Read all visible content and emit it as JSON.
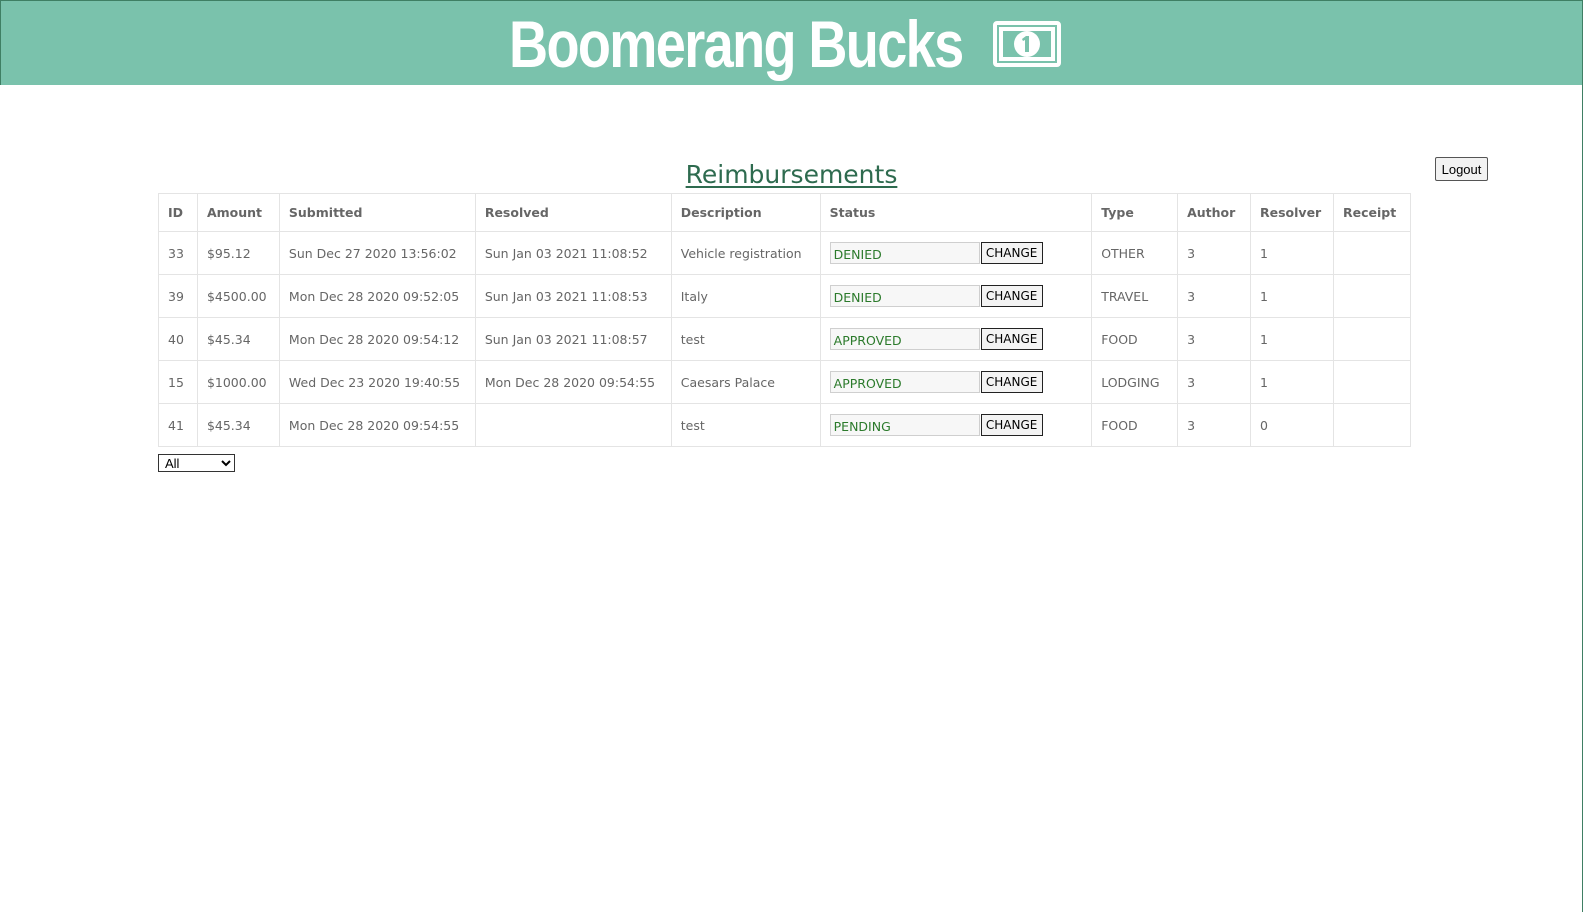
{
  "header": {
    "brand_title": "Boomerang Bucks",
    "icon": "dollar-bill-icon",
    "background_color": "#7ac2ac"
  },
  "page": {
    "title": "Reimbursements",
    "logout_label": "Logout"
  },
  "table": {
    "columns": [
      "ID",
      "Amount",
      "Submitted",
      "Resolved",
      "Description",
      "Status",
      "Type",
      "Author",
      "Resolver",
      "Receipt"
    ],
    "change_label": "CHANGE",
    "rows": [
      {
        "id": "33",
        "amount": "$95.12",
        "submitted": "Sun Dec 27 2020 13:56:02",
        "resolved": "Sun Jan 03 2021 11:08:52",
        "description": "Vehicle registration",
        "status": "DENIED",
        "type": "OTHER",
        "author": "3",
        "resolver": "1",
        "receipt": ""
      },
      {
        "id": "39",
        "amount": "$4500.00",
        "submitted": "Mon Dec 28 2020 09:52:05",
        "resolved": "Sun Jan 03 2021 11:08:53",
        "description": "Italy",
        "status": "DENIED",
        "type": "TRAVEL",
        "author": "3",
        "resolver": "1",
        "receipt": ""
      },
      {
        "id": "40",
        "amount": "$45.34",
        "submitted": "Mon Dec 28 2020 09:54:12",
        "resolved": "Sun Jan 03 2021 11:08:57",
        "description": "test",
        "status": "APPROVED",
        "type": "FOOD",
        "author": "3",
        "resolver": "1",
        "receipt": ""
      },
      {
        "id": "15",
        "amount": "$1000.00",
        "submitted": "Wed Dec 23 2020 19:40:55",
        "resolved": "Mon Dec 28 2020 09:54:55",
        "description": "Caesars Palace",
        "status": "APPROVED",
        "type": "LODGING",
        "author": "3",
        "resolver": "1",
        "receipt": ""
      },
      {
        "id": "41",
        "amount": "$45.34",
        "submitted": "Mon Dec 28 2020 09:54:55",
        "resolved": "",
        "description": "test",
        "status": "PENDING",
        "type": "FOOD",
        "author": "3",
        "resolver": "0",
        "receipt": ""
      }
    ]
  },
  "filter": {
    "selected": "All",
    "options": [
      "All"
    ]
  },
  "colors": {
    "title": "#2e6b4f",
    "status_text": "#2b7a2b"
  }
}
